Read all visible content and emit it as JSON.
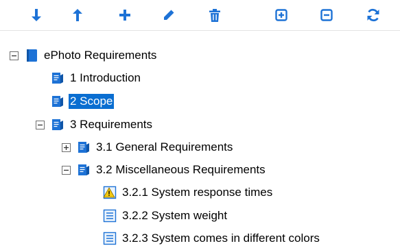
{
  "colors": {
    "accent": "#1d72d6",
    "selection": "#0a6ed1",
    "warning": "#f2c811"
  },
  "toolbar": {
    "buttons": [
      {
        "icon": "arrow-down-icon",
        "name": "move-down-button"
      },
      {
        "icon": "arrow-up-icon",
        "name": "move-up-button"
      },
      {
        "icon": "plus-icon",
        "name": "add-button"
      },
      {
        "icon": "pencil-icon",
        "name": "edit-button"
      },
      {
        "icon": "trash-icon",
        "name": "delete-button"
      },
      {
        "icon": "expand-all-icon",
        "name": "expand-all-button"
      },
      {
        "icon": "collapse-all-icon",
        "name": "collapse-all-button"
      },
      {
        "icon": "refresh-icon",
        "name": "refresh-button"
      }
    ]
  },
  "tree": {
    "nodes": [
      {
        "label": "ePhoto Requirements",
        "icon": "book-icon",
        "expanded": true,
        "level": 0
      },
      {
        "label": "1 Introduction",
        "icon": "document-icon",
        "level": 1
      },
      {
        "label": "2 Scope",
        "icon": "document-icon",
        "level": 1,
        "selected": true
      },
      {
        "label": "3 Requirements",
        "icon": "document-icon",
        "expanded": true,
        "level": 1
      },
      {
        "label": "3.1 General Requirements",
        "icon": "document-icon",
        "expanded": false,
        "level": 2
      },
      {
        "label": "3.2 Miscellaneous Requirements",
        "icon": "document-icon",
        "expanded": true,
        "level": 2
      },
      {
        "label": "3.2.1 System response times",
        "icon": "requirement-warning-icon",
        "level": 3
      },
      {
        "label": "3.2.2 System weight",
        "icon": "requirement-icon",
        "level": 3
      },
      {
        "label": "3.2.3 System comes in different colors",
        "icon": "requirement-icon",
        "level": 3
      }
    ]
  }
}
